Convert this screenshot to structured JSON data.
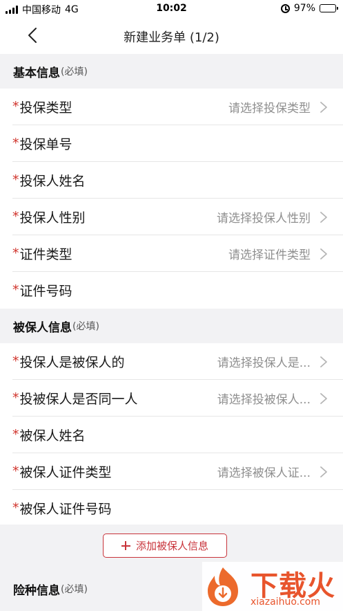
{
  "status_bar": {
    "carrier": "中国移动",
    "network": "4G",
    "time": "10:02",
    "battery": "97%",
    "battery_level": 0.97
  },
  "nav": {
    "title": "新建业务单 (1/2)"
  },
  "sections": {
    "basic": {
      "title": "基本信息",
      "required": "(必填)",
      "rows": [
        {
          "label": "投保类型",
          "value": "请选择投保类型"
        },
        {
          "label": "投保单号",
          "value": ""
        },
        {
          "label": "投保人姓名",
          "value": ""
        },
        {
          "label": "投保人性别",
          "value": "请选择投保人性别"
        },
        {
          "label": "证件类型",
          "value": "请选择证件类型"
        },
        {
          "label": "证件号码",
          "value": ""
        }
      ]
    },
    "insured": {
      "title": "被保人信息",
      "required": "(必填)",
      "rows": [
        {
          "label": "投保人是被保人的",
          "value": "请选择投保人是..."
        },
        {
          "label": "投被保人是否同一人",
          "value": "请选择投被保人..."
        },
        {
          "label": "被保人姓名",
          "value": ""
        },
        {
          "label": "被保人证件类型",
          "value": "请选择被保人证..."
        },
        {
          "label": "被保人证件号码",
          "value": ""
        }
      ],
      "add_button": "添加被保人信息"
    },
    "coverage": {
      "title": "险种信息",
      "required": "(必填)"
    }
  },
  "required_mark": "*",
  "watermark": {
    "text": "下载火",
    "url": "xiazaihuo.com"
  },
  "colors": {
    "accent": "#c8333a",
    "required_star": "#d0342c",
    "placeholder": "#8f8f8f",
    "background": "#f2f2f4",
    "watermark": "#e8542c"
  },
  "icons": [
    "signal-icon",
    "alarm-icon",
    "battery-icon",
    "back-arrow-icon",
    "chevron-right-icon",
    "plus-icon",
    "watermark-logo"
  ]
}
